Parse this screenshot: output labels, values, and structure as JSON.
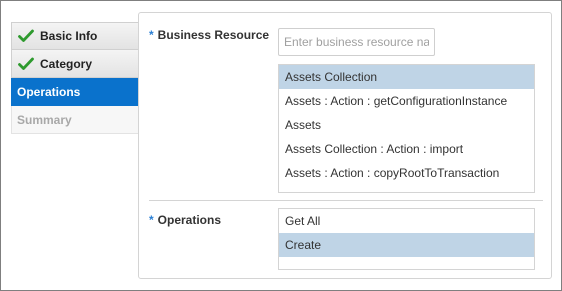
{
  "train": {
    "steps": [
      {
        "label": "Basic Info",
        "state": "completed",
        "icon": "check-icon"
      },
      {
        "label": "Category",
        "state": "completed",
        "icon": "check-icon"
      },
      {
        "label": "Operations",
        "state": "active"
      },
      {
        "label": "Summary",
        "state": "disabled"
      }
    ]
  },
  "form": {
    "required_marker": "*",
    "business_resource": {
      "label": "Business Resource",
      "placeholder": "Enter business resource na",
      "options": [
        {
          "label": "Assets Collection",
          "selected": true
        },
        {
          "label": "Assets : Action : getConfigurationInstance",
          "selected": false
        },
        {
          "label": "Assets",
          "selected": false
        },
        {
          "label": "Assets Collection : Action : import",
          "selected": false
        },
        {
          "label": "Assets : Action : copyRootToTransaction",
          "selected": false
        }
      ]
    },
    "operations": {
      "label": "Operations",
      "options": [
        {
          "label": "Get All",
          "selected": false
        },
        {
          "label": "Create",
          "selected": true
        }
      ]
    }
  },
  "colors": {
    "active_step": "#0a72cc",
    "selected_option": "#bfd4e6",
    "check": "#2e9a2e",
    "required_marker": "#2a7fd4"
  }
}
